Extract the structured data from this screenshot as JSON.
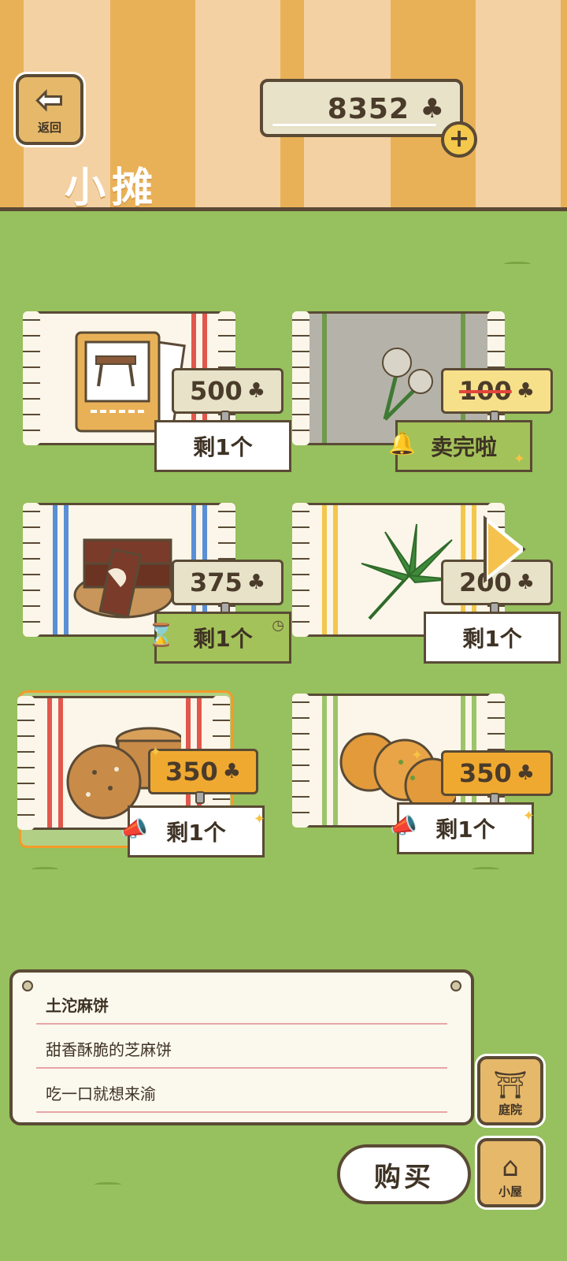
{
  "header": {
    "back_label": "返回",
    "title": "小摊",
    "currency_value": "8352",
    "currency_icon": "clover-icon",
    "add_icon": "plus-icon"
  },
  "items": [
    {
      "name": "postcard-item",
      "price": "500",
      "stock": "剩1个",
      "state": "normal",
      "icon": "price-tag-icon"
    },
    {
      "name": "dandelion-item",
      "price": "100",
      "stock": "卖完啦",
      "state": "sold-out",
      "icon": "bell-icon"
    },
    {
      "name": "chocolate-item",
      "price": "375",
      "stock": "剩1个",
      "state": "timed",
      "icon": "hourglass-icon"
    },
    {
      "name": "leaf-item",
      "price": "200",
      "stock": "剩1个",
      "state": "normal",
      "icon": "price-tag-icon"
    },
    {
      "name": "sesame-cake-item",
      "price": "350",
      "stock": "剩1个",
      "state": "promo",
      "icon": "megaphone-icon"
    },
    {
      "name": "fried-cake-item",
      "price": "350",
      "stock": "剩1个",
      "state": "promo",
      "icon": "megaphone-icon"
    }
  ],
  "description": {
    "title": "土沱麻饼",
    "line1": "甜香酥脆的芝麻饼",
    "line2": "吃一口就想来渝"
  },
  "buttons": {
    "buy_label": "购买",
    "yard_label": "庭院",
    "house_label": "小屋"
  },
  "colors": {
    "background": "#97c05e",
    "accent": "#f0a930",
    "outline": "#5a4a35"
  }
}
